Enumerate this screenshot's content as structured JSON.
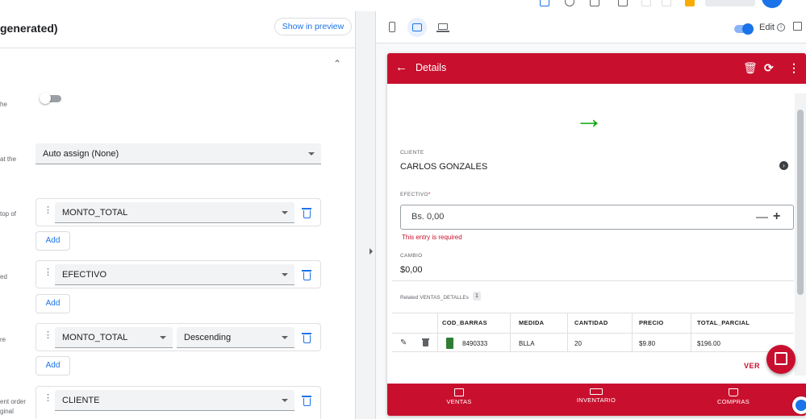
{
  "editor": {
    "header_title": " generated)",
    "show_in_preview": "Show in preview",
    "collapse_icon": "chevron-up-icon",
    "rows": [
      {
        "label": "he"
      },
      {
        "label": "at the"
      },
      {
        "label": "top of"
      },
      {
        "label": "ed"
      },
      {
        "label": "re"
      },
      {
        "label": "ent order"
      },
      {
        "label": "ginal"
      }
    ],
    "assign_select": "Auto assign (None)",
    "fields": {
      "monto_total_1": "MONTO_TOTAL",
      "efectivo": "EFECTIVO",
      "monto_total_2": "MONTO_TOTAL",
      "sort_order": "Descending",
      "cliente": "CLIENTE"
    },
    "add_label": "Add"
  },
  "preview_toolbar": {
    "devices": [
      "phone-icon",
      "tablet-icon",
      "laptop-icon"
    ],
    "edit_label": "Edit",
    "info_symbol": "i"
  },
  "app": {
    "title": "Details",
    "colors": {
      "primary": "#c8102e",
      "accent_green": "#12a812"
    },
    "detail": {
      "cliente_label": "CLIENTE",
      "cliente_value": "CARLOS GONZALES",
      "efectivo_label": "EFECTIVO",
      "efectivo_required_mark": "*",
      "efectivo_value": "Bs. 0,00",
      "error": "This entry is required",
      "cambio_label": "CAMBIO",
      "cambio_value": "$0,00"
    },
    "related": {
      "label": "Related VENTAS_DETALLEs",
      "count": "1",
      "columns": [
        "COD_BARRAS",
        "MEDIDA",
        "CANTIDAD",
        "PRECIO",
        "TOTAL_PARCIAL"
      ],
      "rows": [
        {
          "cod_barras": "8490333",
          "medida": "BLLA",
          "cantidad": "20",
          "precio": "$9.80",
          "total_parcial": "$196.00"
        }
      ],
      "view_label": "VER"
    },
    "nav": [
      {
        "label": "VENTAS",
        "icon": "dollar-icon"
      },
      {
        "label": "INVENTARIO",
        "icon": "inventory-icon"
      },
      {
        "label": "COMPRAS",
        "icon": "cart-icon"
      }
    ]
  }
}
